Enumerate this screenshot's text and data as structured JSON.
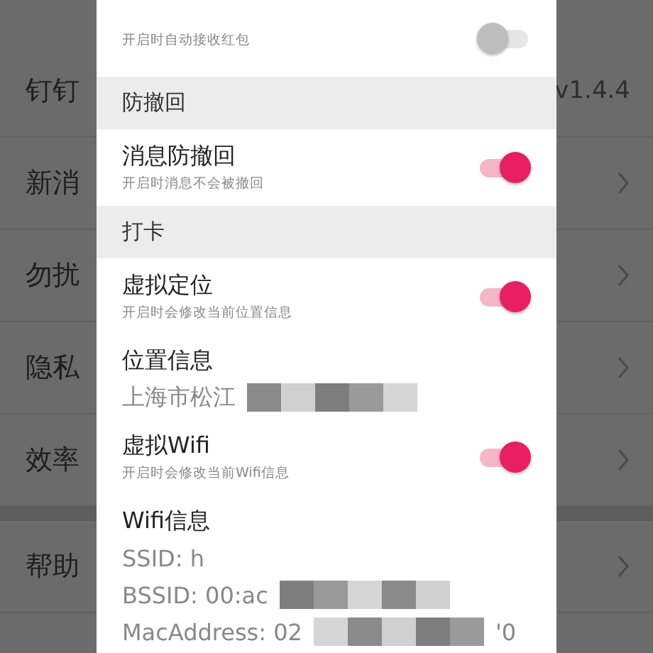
{
  "background_list": {
    "items": [
      {
        "kind": "value",
        "label": "钉钉",
        "value": "v1.4.4"
      },
      {
        "kind": "link",
        "label": "新消"
      },
      {
        "kind": "link",
        "label": "勿扰"
      },
      {
        "kind": "link",
        "label": "隐私"
      },
      {
        "kind": "link",
        "label": "效率"
      },
      {
        "kind": "gap"
      },
      {
        "kind": "link",
        "label": "帮助"
      }
    ]
  },
  "dialog": {
    "items": [
      {
        "kind": "toggle",
        "subtitle": "开启时自动接收红包",
        "on": false
      },
      {
        "kind": "header",
        "title": "防撤回"
      },
      {
        "kind": "toggle",
        "title": "消息防撤回",
        "subtitle": "开启时消息不会被撤回",
        "on": true
      },
      {
        "kind": "header",
        "title": "打卡"
      },
      {
        "kind": "toggle",
        "title": "虚拟定位",
        "subtitle": "开启时会修改当前位置信息",
        "on": true
      },
      {
        "kind": "info",
        "title": "位置信息",
        "lines": [
          {
            "text": "上海市松江",
            "redacted": true
          }
        ]
      },
      {
        "kind": "toggle",
        "title": "虚拟Wifi",
        "subtitle": "开启时会修改当前Wifi信息",
        "on": true
      },
      {
        "kind": "info",
        "title": "Wifi信息",
        "lines": [
          {
            "text": "SSID: h",
            "redacted": false
          },
          {
            "text": "BSSID: 00:ac",
            "redacted": true
          },
          {
            "text": "MacAddress: 02",
            "redacted": true,
            "tail": "'0"
          }
        ]
      }
    ]
  }
}
